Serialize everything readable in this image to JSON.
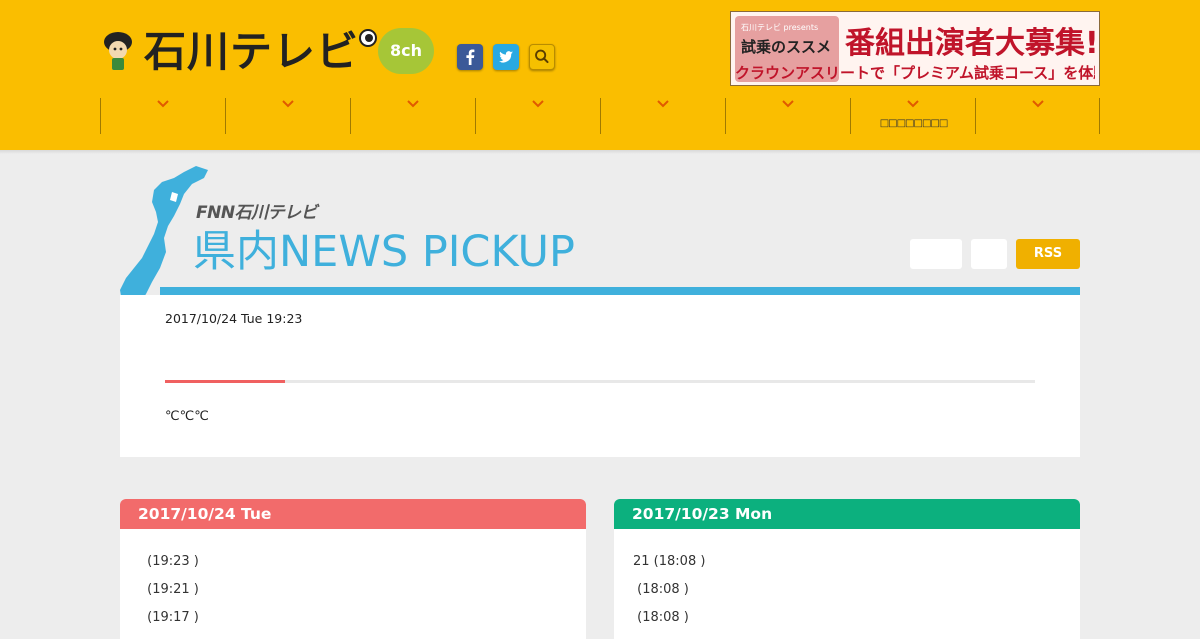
{
  "header": {
    "brand_name": "石川テレビ",
    "channel_badge": "8ch",
    "social": {
      "facebook_icon": "facebook-icon",
      "twitter_icon": "twitter-icon",
      "search_icon": "search-icon"
    },
    "banner": {
      "small_text": "石川テレビ presents",
      "program_title": "試乗のススメ",
      "headline": "番組出演者大募集!",
      "subline": "クラウンアスリートで「プレミアム試乗コース」を体験!"
    },
    "nav_items": [
      "",
      "",
      "",
      "",
      "",
      "",
      "□□□□□□□□",
      ""
    ]
  },
  "news": {
    "brand": "FNN石川テレビ",
    "title": "県内NEWS  PICKUP",
    "rss_label": "RSS",
    "timestamp": "2017/10/24 Tue 19:23",
    "progress": 0.138,
    "weather": "℃℃℃"
  },
  "days": [
    {
      "date": "2017/10/24 Tue",
      "color": "#f26b6b",
      "items": [
        " (19:23 )",
        " (19:21 )",
        " (19:17 )"
      ]
    },
    {
      "date": "2017/10/23 Mon",
      "color": "#0cb07e",
      "items": [
        "21 (18:08 )",
        " (18:08 )",
        " (18:08 )"
      ]
    }
  ],
  "colors": {
    "header_bg": "#fabe00",
    "accent_blue": "#3fb0dc",
    "rss_bg": "#f0b000",
    "progress": "#f06060"
  }
}
